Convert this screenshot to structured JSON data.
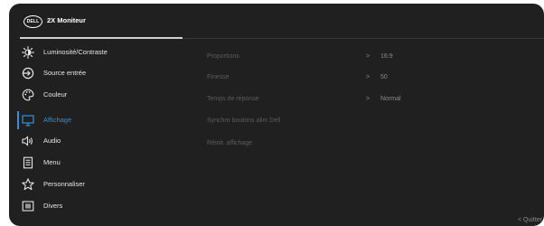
{
  "header": {
    "logo_text": "DELL",
    "title": "2X Moniteur"
  },
  "menu": {
    "items": [
      {
        "label": "Luminosité/Contraste",
        "icon": "brightness-icon"
      },
      {
        "label": "Source entrée",
        "icon": "input-source-icon"
      },
      {
        "label": "Couleur",
        "icon": "color-palette-icon"
      },
      {
        "label": "Affichage",
        "icon": "display-icon",
        "active": true
      },
      {
        "label": "Audio",
        "icon": "speaker-icon"
      },
      {
        "label": "Menu",
        "icon": "menu-document-icon"
      },
      {
        "label": "Personnaliser",
        "icon": "star-icon"
      },
      {
        "label": "Divers",
        "icon": "info-icon"
      }
    ]
  },
  "submenu": {
    "rows": [
      {
        "label": "Proportions",
        "arrow": ">",
        "value": "16:9"
      },
      {
        "label": "Finesse",
        "arrow": ">",
        "value": "50"
      },
      {
        "label": "Temps de réponse",
        "arrow": ">",
        "value": "Normal"
      },
      {
        "label": "Synchro boutons alim Dell"
      },
      {
        "label": "Réinit. affichage"
      }
    ]
  },
  "footer": {
    "quit_label": "< Quitter"
  },
  "colors": {
    "background": "#202020",
    "accent": "#3a8fd6",
    "text": "#e6e6e6",
    "muted": "#5c5c5c"
  }
}
